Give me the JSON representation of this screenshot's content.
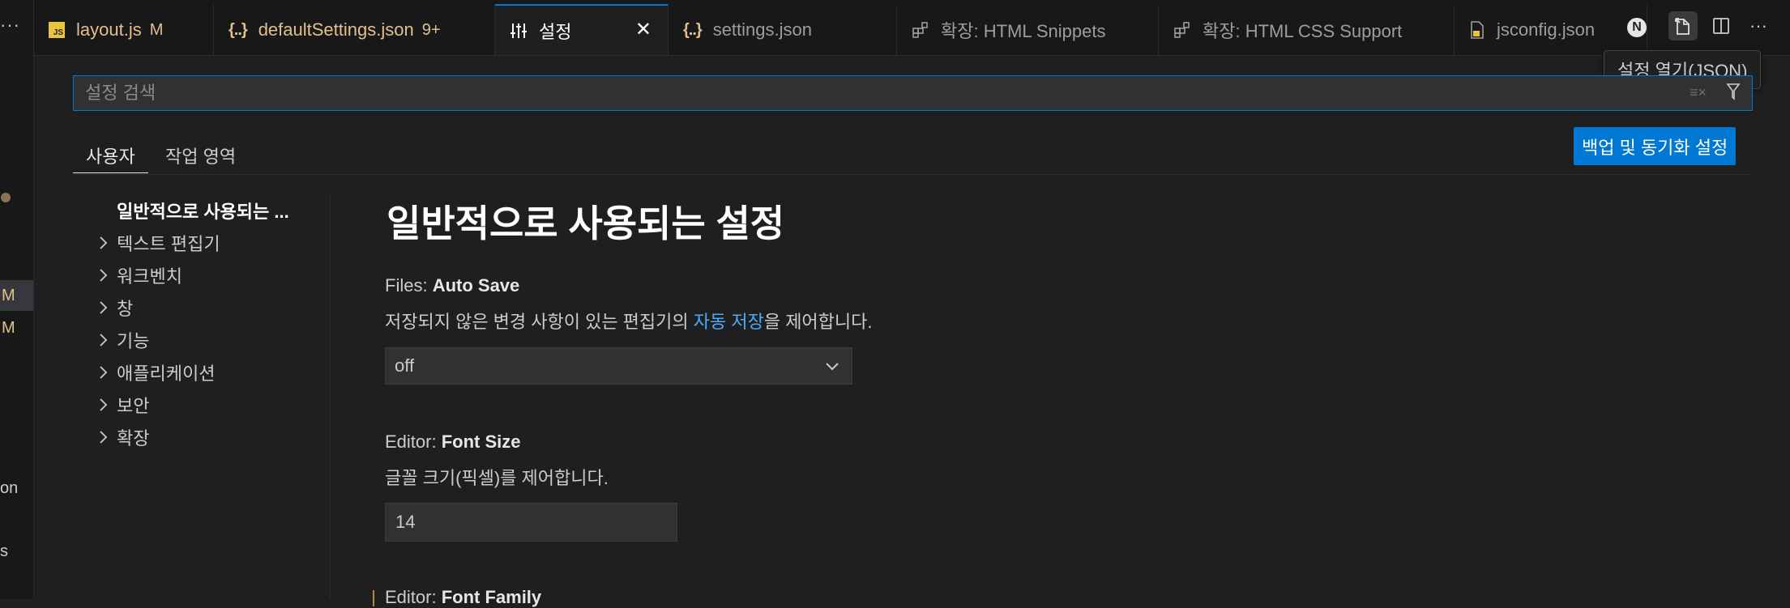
{
  "left_strip": {
    "more_label": "···",
    "modified_1": "M",
    "modified_2": "M",
    "partial_text_1": "on",
    "partial_text_2": "s"
  },
  "tabs": [
    {
      "label": "layout.js",
      "badge": "M",
      "icon": "javascript-file-icon"
    },
    {
      "label": "defaultSettings.json",
      "badge": "9+",
      "icon": "json-braces-icon"
    },
    {
      "label": "설정",
      "icon": "settings-sliders-icon",
      "close": "✕"
    },
    {
      "label": "settings.json",
      "icon": "json-braces-icon"
    },
    {
      "label": "확장: HTML Snippets",
      "icon": "extensions-icon"
    },
    {
      "label": "확장: HTML CSS Support",
      "icon": "extensions-icon"
    },
    {
      "label": "jsconfig.json",
      "icon": "js-config-file-icon"
    }
  ],
  "toolbar": {
    "n_badge": "N",
    "tooltip": "설정 열기(JSON)",
    "more": "···"
  },
  "search": {
    "placeholder": "설정 검색",
    "value": ""
  },
  "scope_tabs": {
    "user": "사용자",
    "workspace": "작업 영역"
  },
  "backup_button": "백업 및 동기화 설정",
  "toc": {
    "first": "일반적으로 사용되는 ...",
    "items": [
      "텍스트 편집기",
      "워크벤치",
      "창",
      "기능",
      "애플리케이션",
      "보안",
      "확장"
    ]
  },
  "content": {
    "section_title": "일반적으로 사용되는 설정",
    "auto_save": {
      "category": "Files: ",
      "name": "Auto Save",
      "desc_before": "저장되지 않은 변경 사항이 있는 편집기의 ",
      "desc_link": "자동 저장",
      "desc_after": "을 제어합니다.",
      "value": "off"
    },
    "font_size": {
      "category": "Editor: ",
      "name": "Font Size",
      "desc": "글꼴 크기(픽셀)를 제어합니다.",
      "value": "14"
    },
    "font_family": {
      "category": "Editor: ",
      "name": "Font Family"
    }
  }
}
